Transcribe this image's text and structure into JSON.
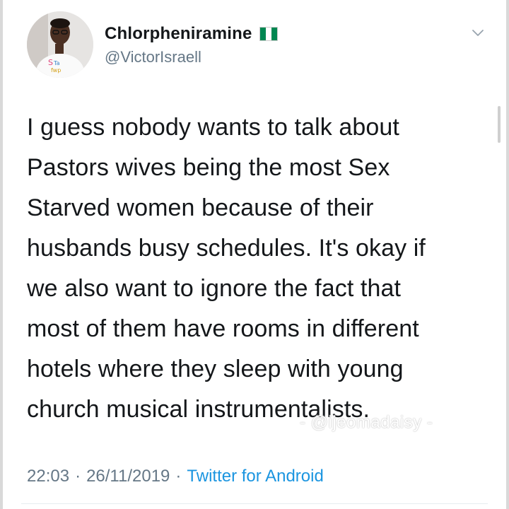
{
  "tweet": {
    "display_name": "Chlorpheniramine",
    "handle": "@VictorIsraell",
    "flag_icon": "nigeria-flag-icon",
    "menu_icon": "chevron-down-icon",
    "text_lines": [
      "I guess nobody wants to talk about",
      "Pastors wives being the most Sex",
      "Starved women because of their",
      "husbands busy schedules. It's okay if",
      "we also want to ignore the fact that",
      "most of them have rooms in different",
      "hotels where they sleep with young",
      "church musical instrumentalists."
    ],
    "time": "22:03",
    "date": "26/11/2019",
    "separator": "·",
    "source": "Twitter for Android",
    "watermark": "- @ijeomadaisy -"
  },
  "colors": {
    "text": "#14171a",
    "secondary": "#657786",
    "link": "#1b95e0",
    "flag_green": "#008751",
    "flag_white": "#ffffff"
  }
}
